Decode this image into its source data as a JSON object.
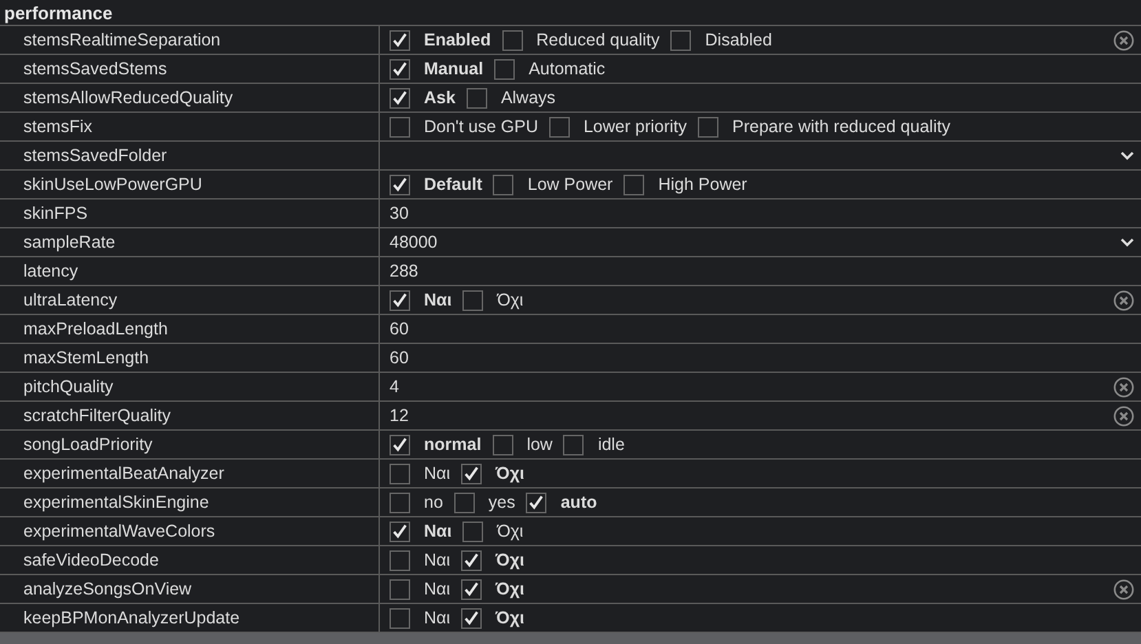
{
  "section": {
    "title": "performance"
  },
  "rows": [
    {
      "name": "stemsRealtimeSeparation",
      "kind": "options",
      "clearable": true,
      "options": [
        {
          "label": "Enabled",
          "checked": true
        },
        {
          "label": "Reduced quality",
          "checked": false
        },
        {
          "label": "Disabled",
          "checked": false
        }
      ]
    },
    {
      "name": "stemsSavedStems",
      "kind": "options",
      "clearable": false,
      "options": [
        {
          "label": "Manual",
          "checked": true
        },
        {
          "label": "Automatic",
          "checked": false
        }
      ]
    },
    {
      "name": "stemsAllowReducedQuality",
      "kind": "options",
      "clearable": false,
      "options": [
        {
          "label": "Ask",
          "checked": true
        },
        {
          "label": "Always",
          "checked": false
        }
      ]
    },
    {
      "name": "stemsFix",
      "kind": "options",
      "clearable": false,
      "options": [
        {
          "label": "Don't use GPU",
          "checked": false
        },
        {
          "label": "Lower priority",
          "checked": false
        },
        {
          "label": "Prepare with reduced quality",
          "checked": false
        }
      ]
    },
    {
      "name": "stemsSavedFolder",
      "kind": "dropdown",
      "clearable": false
    },
    {
      "name": "skinUseLowPowerGPU",
      "kind": "options",
      "clearable": false,
      "options": [
        {
          "label": "Default",
          "checked": true
        },
        {
          "label": "Low Power",
          "checked": false
        },
        {
          "label": "High Power",
          "checked": false
        }
      ]
    },
    {
      "name": "skinFPS",
      "kind": "text",
      "clearable": false,
      "value": "30"
    },
    {
      "name": "sampleRate",
      "kind": "dropdown",
      "clearable": false,
      "value": "48000"
    },
    {
      "name": "latency",
      "kind": "text",
      "clearable": false,
      "value": "288"
    },
    {
      "name": "ultraLatency",
      "kind": "options",
      "clearable": true,
      "options": [
        {
          "label": "Ναι",
          "checked": true
        },
        {
          "label": "Όχι",
          "checked": false
        }
      ]
    },
    {
      "name": "maxPreloadLength",
      "kind": "text",
      "clearable": false,
      "value": "60"
    },
    {
      "name": "maxStemLength",
      "kind": "text",
      "clearable": false,
      "value": "60"
    },
    {
      "name": "pitchQuality",
      "kind": "text",
      "clearable": true,
      "value": "4"
    },
    {
      "name": "scratchFilterQuality",
      "kind": "text",
      "clearable": true,
      "value": "12"
    },
    {
      "name": "songLoadPriority",
      "kind": "options",
      "clearable": false,
      "options": [
        {
          "label": "normal",
          "checked": true
        },
        {
          "label": "low",
          "checked": false
        },
        {
          "label": "idle",
          "checked": false
        }
      ]
    },
    {
      "name": "experimentalBeatAnalyzer",
      "kind": "options",
      "clearable": false,
      "options": [
        {
          "label": "Ναι",
          "checked": false
        },
        {
          "label": "Όχι",
          "checked": true
        }
      ]
    },
    {
      "name": "experimentalSkinEngine",
      "kind": "options",
      "clearable": false,
      "options": [
        {
          "label": "no",
          "checked": false
        },
        {
          "label": "yes",
          "checked": false
        },
        {
          "label": "auto",
          "checked": true
        }
      ]
    },
    {
      "name": "experimentalWaveColors",
      "kind": "options",
      "clearable": false,
      "options": [
        {
          "label": "Ναι",
          "checked": true
        },
        {
          "label": "Όχι",
          "checked": false
        }
      ]
    },
    {
      "name": "safeVideoDecode",
      "kind": "options",
      "clearable": false,
      "options": [
        {
          "label": "Ναι",
          "checked": false
        },
        {
          "label": "Όχι",
          "checked": true
        }
      ]
    },
    {
      "name": "analyzeSongsOnView",
      "kind": "options",
      "clearable": true,
      "options": [
        {
          "label": "Ναι",
          "checked": false
        },
        {
          "label": "Όχι",
          "checked": true
        }
      ]
    },
    {
      "name": "keepBPMonAnalyzerUpdate",
      "kind": "options",
      "clearable": false,
      "options": [
        {
          "label": "Ναι",
          "checked": false
        },
        {
          "label": "Όχι",
          "checked": true
        }
      ]
    }
  ]
}
